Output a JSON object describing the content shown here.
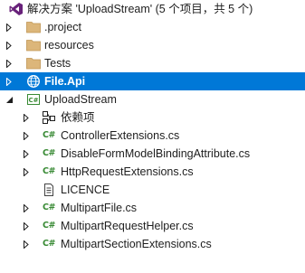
{
  "solution_explorer": {
    "solution_label": "解决方案 'UploadStream' (5 个项目，共 5 个)",
    "items": [
      {
        "label": ".project",
        "kind": "folder",
        "expanded": false
      },
      {
        "label": "resources",
        "kind": "folder",
        "expanded": false
      },
      {
        "label": "Tests",
        "kind": "folder",
        "expanded": false
      },
      {
        "label": "File.Api",
        "kind": "web-project",
        "expanded": false,
        "selected": true
      },
      {
        "label": "UploadStream",
        "kind": "csharp-project",
        "expanded": true
      }
    ],
    "children": [
      {
        "label": "依赖项",
        "kind": "dependencies",
        "expanded": false
      },
      {
        "label": "ControllerExtensions.cs",
        "kind": "csharp-file",
        "expanded": false
      },
      {
        "label": "DisableFormModelBindingAttribute.cs",
        "kind": "csharp-file",
        "expanded": false
      },
      {
        "label": "HttpRequestExtensions.cs",
        "kind": "csharp-file",
        "expanded": false
      },
      {
        "label": "LICENCE",
        "kind": "file"
      },
      {
        "label": "MultipartFile.cs",
        "kind": "csharp-file",
        "expanded": false
      },
      {
        "label": "MultipartRequestHelper.cs",
        "kind": "csharp-file",
        "expanded": false
      },
      {
        "label": "MultipartSectionExtensions.cs",
        "kind": "csharp-file",
        "expanded": false
      }
    ],
    "colors": {
      "selection": "#0078d7",
      "folder": "#dcb67a",
      "csharp": "#388a34",
      "vs_purple": "#68217a"
    }
  }
}
